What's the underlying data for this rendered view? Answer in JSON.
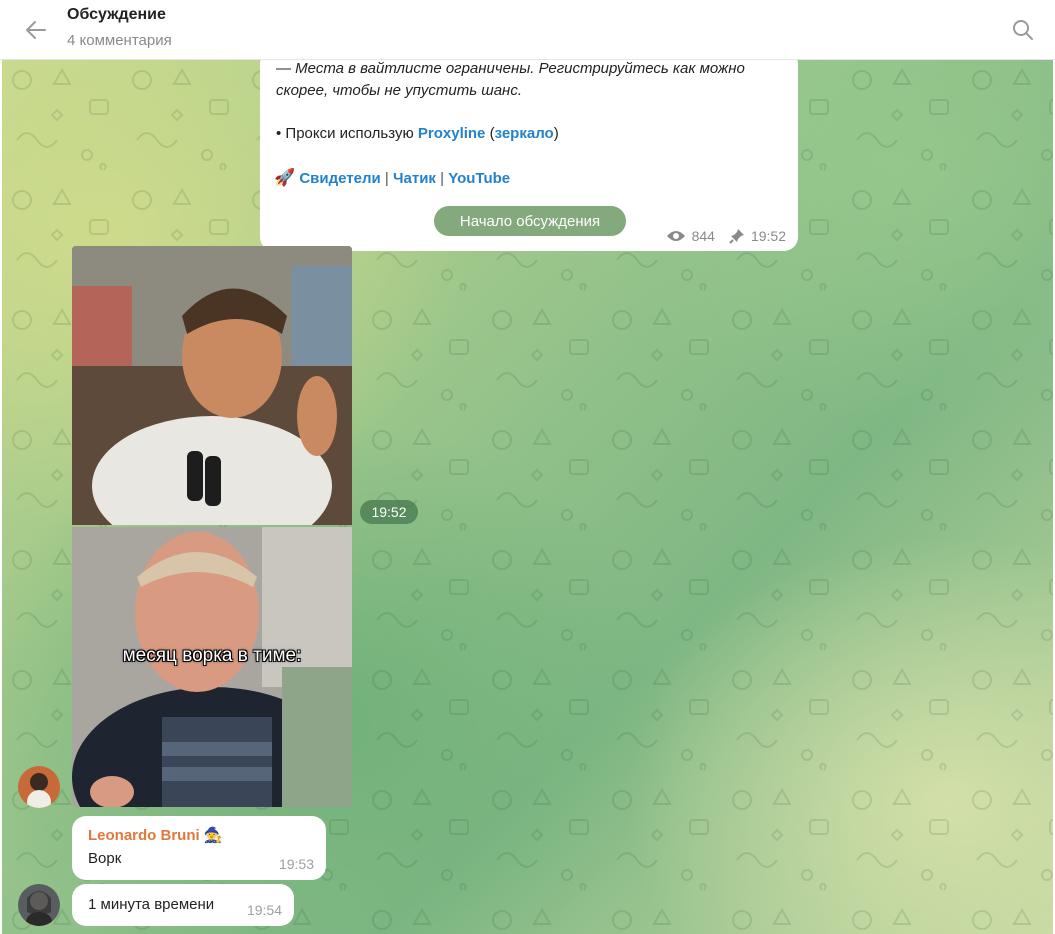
{
  "header": {
    "title": "Обсуждение",
    "subtitle": "4 комментария"
  },
  "post": {
    "line1": "— Места в вайтлисте ограничены. Регистрируйтесь как можно",
    "line2": "скорее, чтобы не упустить шанс.",
    "proxy_prefix": "• Прокси использую ",
    "proxy_link": "Proxyline",
    "mirror_open": " (",
    "mirror_link": "зеркало",
    "mirror_close": ")",
    "links": [
      "Свидетели",
      "Чатик",
      "YouTube"
    ],
    "separator": "|",
    "views": "844",
    "time": "19:52"
  },
  "divider": "Начало обсуждения",
  "media_group": {
    "time": "19:52",
    "caption": "месяц ворка в тиме:"
  },
  "messages": [
    {
      "sender": "Leonardo Bruni",
      "text": "Ворк",
      "time": "19:53"
    },
    {
      "text": "1 минута времени",
      "time": "19:54"
    }
  ],
  "colors": {
    "accent": "#2481cc",
    "sender_name": "#e0783a",
    "pill": "#5a8c50"
  }
}
